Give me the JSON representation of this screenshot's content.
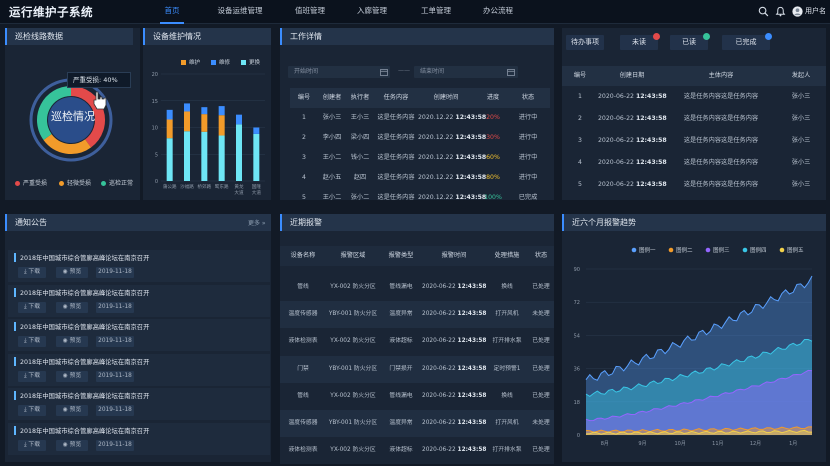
{
  "app": {
    "title": "运行维护子系统",
    "user": "用户名"
  },
  "nav": [
    "首页",
    "设备运维管理",
    "值班管理",
    "入廊管理",
    "工单管理",
    "办公流程"
  ],
  "panels": {
    "inspection": "巡检线路数据",
    "maintenance": "设备维护情况",
    "work": "工作详情",
    "notice": "通知公告",
    "alarm": "近期报警",
    "trend": "近六个月报警趋势"
  },
  "inspection": {
    "center_label": "巡检情况",
    "tooltip": "严重受损",
    "tooltip_value": "40%",
    "legend": [
      {
        "name": "严重受损",
        "color": "#e34a4a"
      },
      {
        "name": "轻微受损",
        "color": "#f29b2a"
      },
      {
        "name": "巡检正常",
        "color": "#36c39a"
      }
    ],
    "ring": [
      {
        "value": 40,
        "color": "#e34a4a"
      },
      {
        "value": 25,
        "color": "#f29b2a"
      },
      {
        "value": 35,
        "color": "#36c39a"
      }
    ]
  },
  "maintenance": {
    "legend": [
      {
        "name": "维护",
        "color": "#f29b2a"
      },
      {
        "name": "维修",
        "color": "#3b8dff"
      },
      {
        "name": "更换",
        "color": "#6ee6f5"
      }
    ]
  },
  "chart_data": [
    {
      "type": "bar",
      "stacked": true,
      "categories": [
        "蒲公路",
        "沙福路",
        "桥郊路",
        "鹭东路",
        "黄龙大道",
        "国隆大道"
      ],
      "ylim": [
        0,
        20
      ],
      "yticks": [
        0,
        5,
        10,
        15,
        20
      ],
      "series": [
        {
          "name": "更换",
          "values": [
            8,
            9.3,
            9.2,
            8.5,
            10.6,
            8.8
          ]
        },
        {
          "name": "维护",
          "values": [
            3.5,
            3.7,
            3.3,
            3.8,
            0,
            0
          ]
        },
        {
          "name": "维修",
          "values": [
            1.8,
            1.5,
            1.3,
            1.7,
            1.8,
            1.2
          ]
        }
      ]
    },
    {
      "type": "area",
      "x_labels": [
        "8月",
        "9月",
        "10月",
        "11月",
        "12月",
        "1月"
      ],
      "ylim": [
        0,
        90
      ],
      "yticks": [
        0,
        18,
        36,
        54,
        72,
        90
      ],
      "legend_position": "top",
      "series": [
        {
          "name": "图例一",
          "color": "#5aa0ff",
          "start": 30,
          "end": 84
        },
        {
          "name": "图例二",
          "color": "#f29b2a",
          "start": 2,
          "end": 4
        },
        {
          "name": "图例三",
          "color": "#9466ff",
          "start": 8,
          "end": 35
        },
        {
          "name": "图例四",
          "color": "#39c6e6",
          "start": 22,
          "end": 52
        },
        {
          "name": "图例五",
          "color": "#f2d14a",
          "start": 1,
          "end": 2
        }
      ]
    }
  ],
  "work": {
    "start_placeholder": "开始时间",
    "end_placeholder": "结束时间",
    "separator": "——",
    "headers": [
      "编号",
      "创建者",
      "执行者",
      "任务内容",
      "创建时间",
      "进度",
      "状态"
    ],
    "rows": [
      {
        "no": "1",
        "creator": "张小三",
        "executor": "王小三",
        "content": "这是任务内容",
        "date": "2020.12.22",
        "time": "12:43:58",
        "progress": "20%",
        "pcolor": "#e34a4a",
        "status": "进行中"
      },
      {
        "no": "2",
        "creator": "李小四",
        "executor": "梁小四",
        "content": "这是任务内容",
        "date": "2020.12.22",
        "time": "12:43:58",
        "progress": "30%",
        "pcolor": "#e34a4a",
        "status": "进行中"
      },
      {
        "no": "3",
        "creator": "王小二",
        "executor": "钱小二",
        "content": "这是任务内容",
        "date": "2020.12.22",
        "time": "12:43:58",
        "progress": "60%",
        "pcolor": "#f2c230",
        "status": "进行中"
      },
      {
        "no": "4",
        "creator": "赵小五",
        "executor": "赵四",
        "content": "这是任务内容",
        "date": "2020.12.22",
        "time": "12:43:58",
        "progress": "80%",
        "pcolor": "#f2c230",
        "status": "进行中"
      },
      {
        "no": "5",
        "creator": "王小二",
        "executor": "张小二",
        "content": "这是任务内容",
        "date": "2020.12.22",
        "time": "12:43:58",
        "progress": "100%",
        "pcolor": "#36c39a",
        "status": "已完成"
      }
    ]
  },
  "todo": {
    "tabs": [
      {
        "label": "待办事项",
        "badge": ""
      },
      {
        "label": "未读",
        "badge": "#e34a4a"
      },
      {
        "label": "已读",
        "badge": "#36c39a"
      },
      {
        "label": "已完成",
        "badge": "#3b8dff"
      }
    ],
    "headers": [
      "编号",
      "创建日期",
      "主体内容",
      "发起人"
    ],
    "rows": [
      {
        "no": "1",
        "date": "2020-06-22",
        "time": "12:43:58",
        "content": "这是任务内容这是任务内容",
        "person": "张小三"
      },
      {
        "no": "2",
        "date": "2020-06-22",
        "time": "12:43:58",
        "content": "这是任务内容这是任务内容",
        "person": "张小三"
      },
      {
        "no": "3",
        "date": "2020-06-22",
        "time": "12:43:58",
        "content": "这是任务内容这是任务内容",
        "person": "张小三"
      },
      {
        "no": "4",
        "date": "2020-06-22",
        "time": "12:43:58",
        "content": "这是任务内容这是任务内容",
        "person": "张小三"
      },
      {
        "no": "5",
        "date": "2020-06-22",
        "time": "12:43:58",
        "content": "这是任务内容这是任务内容",
        "person": "张小三"
      }
    ]
  },
  "notice": {
    "more": "更多",
    "items": [
      {
        "title": "2018年中国城市综合管廊高峰论坛在南京召开",
        "download": "下载",
        "preview": "预览",
        "date": "2019-11-18"
      },
      {
        "title": "2018年中国城市综合管廊高峰论坛在南京召开",
        "download": "下载",
        "preview": "预览",
        "date": "2019-11-18"
      },
      {
        "title": "2018年中国城市综合管廊高峰论坛在南京召开",
        "download": "下载",
        "preview": "预览",
        "date": "2019-11-18"
      },
      {
        "title": "2018年中国城市综合管廊高峰论坛在南京召开",
        "download": "下载",
        "preview": "预览",
        "date": "2019-11-18"
      },
      {
        "title": "2018年中国城市综合管廊高峰论坛在南京召开",
        "download": "下载",
        "preview": "预览",
        "date": "2019-11-18"
      },
      {
        "title": "2018年中国城市综合管廊高峰论坛在南京召开",
        "download": "下载",
        "preview": "预览",
        "date": "2019-11-18"
      }
    ]
  },
  "alarm": {
    "headers": [
      "设备名称",
      "报警区域",
      "报警类型",
      "报警时间",
      "处理措施",
      "状态"
    ],
    "rows": [
      {
        "device": "管线",
        "area": "YX-002 防火分区",
        "type": "管线漏电",
        "date": "2020-06-22",
        "time": "12:43:58",
        "action": "换线",
        "status": "已处理"
      },
      {
        "device": "温度传感器",
        "area": "YBY-001 防火分区",
        "type": "温度异常",
        "date": "2020-06-22",
        "time": "12:43:58",
        "action": "打开风机",
        "status": "未处理"
      },
      {
        "device": "液体检测表",
        "area": "YX-002 防火分区",
        "type": "液体超标",
        "date": "2020-06-22",
        "time": "12:43:58",
        "action": "打开排水泵",
        "status": "已处理"
      },
      {
        "device": "门禁",
        "area": "YBY-001 防火分区",
        "type": "门禁损开",
        "date": "2020-06-22",
        "time": "12:43:58",
        "action": "定时预警1",
        "status": "已处理"
      },
      {
        "device": "管线",
        "area": "YX-002 防火分区",
        "type": "管线漏电",
        "date": "2020-06-22",
        "time": "12:43:58",
        "action": "换线",
        "status": "已处理"
      },
      {
        "device": "温度传感器",
        "area": "YBY-001 防火分区",
        "type": "温度异常",
        "date": "2020-06-22",
        "time": "12:43:58",
        "action": "打开风机",
        "status": "未处理"
      },
      {
        "device": "液体检测表",
        "area": "YX-002 防火分区",
        "type": "液体超标",
        "date": "2020-06-22",
        "time": "12:43:58",
        "action": "打开排水泵",
        "status": "已处理"
      }
    ]
  }
}
